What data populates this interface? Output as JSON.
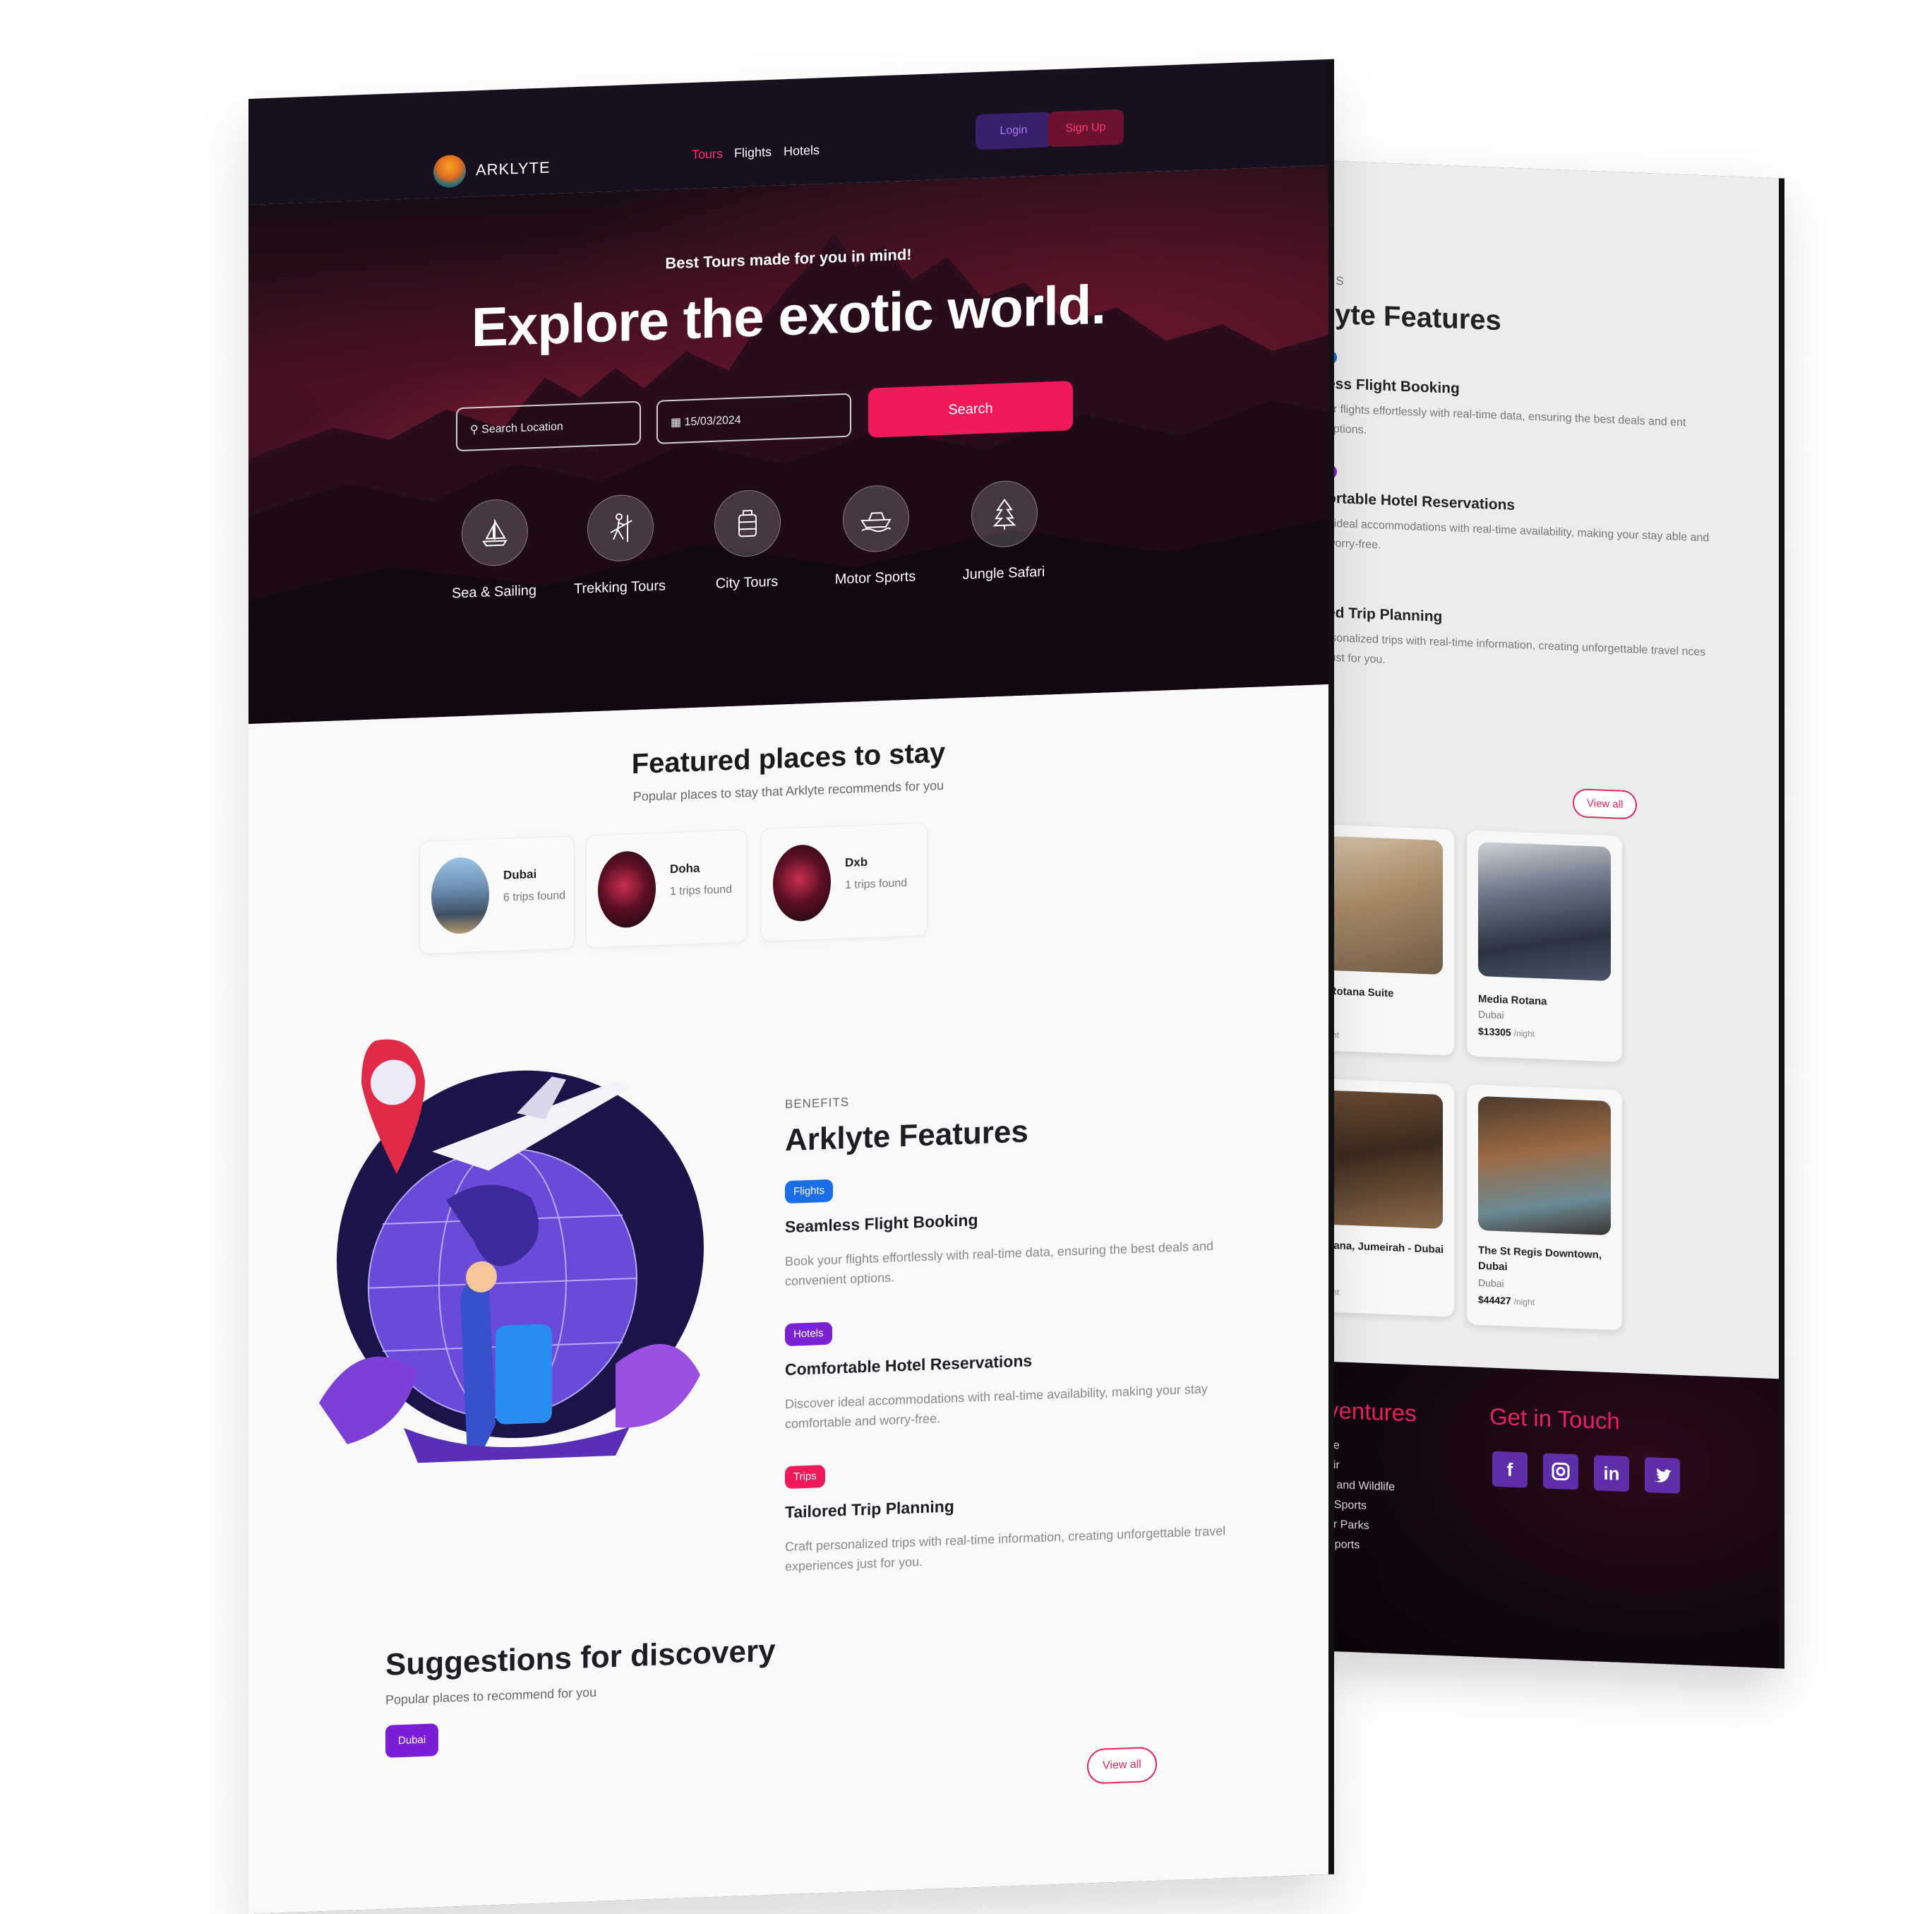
{
  "brand": {
    "name": "ARKLYTE"
  },
  "nav": {
    "links": [
      "Tours",
      "Flights",
      "Hotels"
    ],
    "active": "Tours",
    "login": "Login",
    "signup": "Sign Up"
  },
  "hero": {
    "subtitle": "Best Tours made for you in mind!",
    "title": "Explore the exotic world.",
    "search_placeholder": "Search Location",
    "date_value": "15/03/2024",
    "search_button": "Search",
    "categories": [
      {
        "label": "Sea & Sailing",
        "icon": "sailboat-icon"
      },
      {
        "label": "Trekking Tours",
        "icon": "hiker-icon"
      },
      {
        "label": "City Tours",
        "icon": "luggage-icon"
      },
      {
        "label": "Motor Sports",
        "icon": "speedboat-icon"
      },
      {
        "label": "Jungle Safari",
        "icon": "tree-icon"
      }
    ]
  },
  "featured": {
    "title": "Featured places to stay",
    "subtitle": "Popular places to stay that Arklyte recommends for you",
    "places": [
      {
        "name": "Dubai",
        "count": "6 trips found"
      },
      {
        "name": "Doha",
        "count": "1 trips found"
      },
      {
        "name": "Dxb",
        "count": "1 trips found"
      }
    ]
  },
  "features": {
    "eyebrow": "BENEFITS",
    "title": "Arklyte Features",
    "items": [
      {
        "tag": "Flights",
        "color": "#1a6ee8",
        "title": "Seamless Flight Booking",
        "desc": "Book your flights effortlessly with real-time data, ensuring the best deals and convenient options."
      },
      {
        "tag": "Hotels",
        "color": "#7a22d4",
        "title": "Comfortable Hotel Reservations",
        "desc": "Discover ideal accommodations with real-time availability, making your stay comfortable and worry-free."
      },
      {
        "tag": "Trips",
        "color": "#f0195a",
        "title": "Tailored Trip Planning",
        "desc": "Craft personalized trips with real-time information, creating unforgettable travel experiences just for you."
      }
    ]
  },
  "suggestions": {
    "title": "Suggestions for discovery",
    "subtitle": "Popular places to recommend for you",
    "tag": "Dubai",
    "view_all": "View all"
  },
  "back": {
    "eyebrow": "TS",
    "title": "lyte Features",
    "features": [
      {
        "title": "ess Flight Booking",
        "desc": "ur flights effortlessly with real-time data, ensuring the best deals and ent options."
      },
      {
        "title": "ortable Hotel Reservations",
        "desc": "r ideal accommodations with real-time availability, making your stay able and worry-free."
      },
      {
        "title": "ed Trip Planning",
        "desc": "rsonalized trips with real-time information, creating unforgettable travel nces just for you."
      }
    ],
    "view_all": "View all",
    "hotels": [
      {
        "name": "daf Rotana Suite",
        "city": "",
        "price": "0",
        "unit": "/night"
      },
      {
        "name": "Media Rotana",
        "city": "Dubai",
        "price": "$13305",
        "unit": "/night"
      },
      {
        "name": "j Rotana, Jumeirah - Dubai",
        "city": "",
        "price": "8",
        "unit": "/night"
      },
      {
        "name": "The St Regis Downtown, Dubai",
        "city": "Dubai",
        "price": "$44427",
        "unit": "/night"
      }
    ],
    "footer": {
      "adventures_title": "ventures",
      "adventures": [
        "ne",
        "air",
        "e and Wildlife",
        "r Sports",
        "or Parks",
        "Sports"
      ],
      "contact_title": "Get in Touch",
      "socials": [
        "facebook-icon",
        "instagram-icon",
        "linkedin-icon",
        "twitter-icon"
      ]
    }
  },
  "colors": {
    "accent": "#f0195a",
    "purple": "#7a22d4",
    "blue": "#1a6ee8",
    "dark": "#16101f"
  }
}
